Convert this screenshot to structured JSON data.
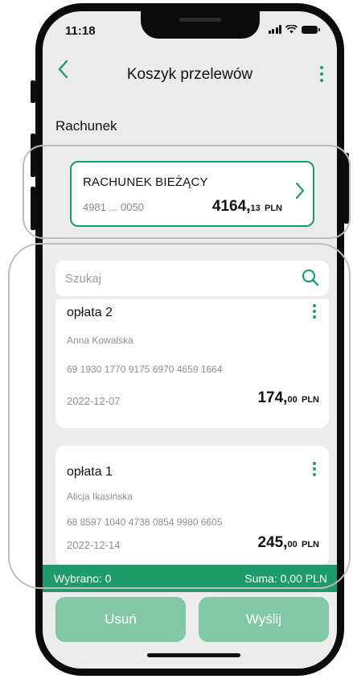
{
  "status": {
    "time": "11:18"
  },
  "header": {
    "title": "Koszyk przelewów"
  },
  "section": {
    "label": "Rachunek"
  },
  "account": {
    "name": "RACHUNEK BIEŻĄCY",
    "number": "4981 ... 0050",
    "amount_main": "4164,",
    "amount_cents": "13",
    "currency": "PLN"
  },
  "search": {
    "placeholder": "Szukaj"
  },
  "transfers": [
    {
      "title": "opłata 2",
      "recipient": "Anna Kowalska",
      "account": "69 1930 1770 9175 6970 4659 1664",
      "date": "2022-12-07",
      "amount_main": "174,",
      "amount_cents": "00",
      "currency": "PLN"
    },
    {
      "title": "opłata 1",
      "recipient": "Alicja Ikasińska",
      "account": "68 8597 1040 4738 0854 9980 6605",
      "date": "2022-12-14",
      "amount_main": "245,",
      "amount_cents": "00",
      "currency": "PLN"
    }
  ],
  "summary": {
    "selected": "Wybrano: 0",
    "total": "Suma: 0,00 PLN"
  },
  "actions": {
    "delete_label": "Usuń",
    "send_label": "Wyślij"
  },
  "colors": {
    "accent": "#1e9b6a",
    "button_disabled": "#82c7a6",
    "background": "#ececec"
  }
}
